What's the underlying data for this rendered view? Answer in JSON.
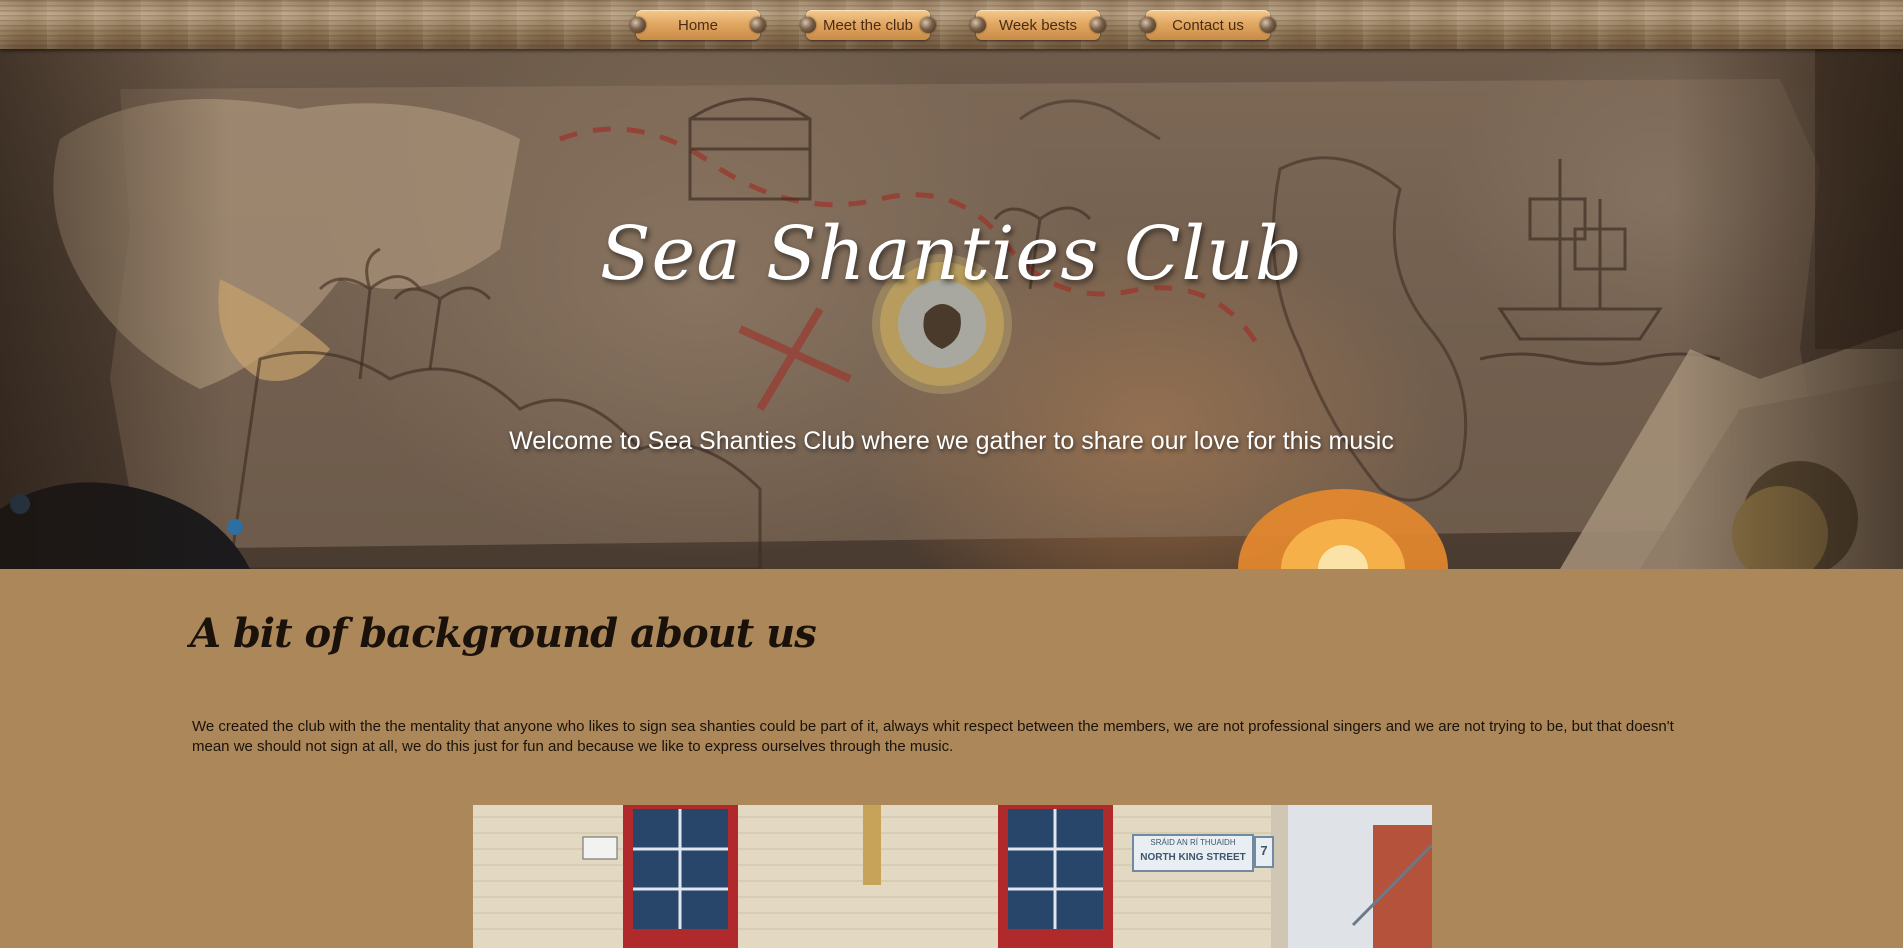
{
  "nav": {
    "items": [
      {
        "label": "Home"
      },
      {
        "label": "Meet the club"
      },
      {
        "label": "Week bests"
      },
      {
        "label": "Contact us"
      }
    ]
  },
  "hero": {
    "title": "Sea Shanties Club",
    "subtitle": "Welcome to Sea Shanties Club where we gather to share our love for this music"
  },
  "about": {
    "heading": "A bit of background about us",
    "text": "We created the club with the the mentality that anyone who likes to sign sea shanties could be part of it, always whit respect between the members, we are not professional singers and we are not trying to be, but that doesn't mean we should not sign at all, we do this just for fun and because we like to express ourselves through the music."
  },
  "photo": {
    "sign_line1": "SRÁID AN RÍ THUAIDH",
    "sign_line2": "NORTH KING STREET",
    "sign_number": "7"
  },
  "colors": {
    "page_background": "#ab8759",
    "nav_button": "#e2a863",
    "nav_text": "#4a2c16",
    "hero_text": "#ffffff",
    "heading_text": "#1a120a"
  }
}
